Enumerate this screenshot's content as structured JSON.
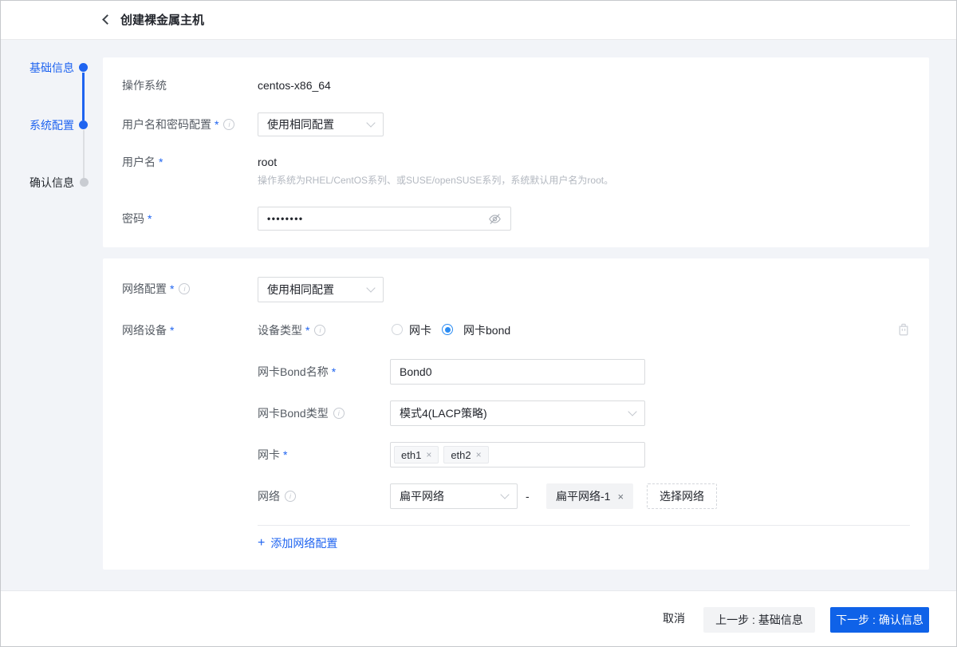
{
  "colors": {
    "primary": "#0f62e8",
    "link": "#1f64f0",
    "radio": "#2b8cf3",
    "text": "#23262d",
    "label": "#555b63",
    "hint": "#b3b8c0",
    "border": "#d9dbde",
    "page_bg": "#f2f4f8"
  },
  "icons": {
    "close": "×",
    "plus": "+"
  },
  "marks": {
    "required": "*"
  },
  "header": {
    "title": "创建裸金属主机"
  },
  "stepper": {
    "steps": [
      {
        "label": "基础信息",
        "state": "done"
      },
      {
        "label": "系统配置",
        "state": "active"
      },
      {
        "label": "确认信息",
        "state": "pending"
      }
    ]
  },
  "system_card": {
    "os_label": "操作系统",
    "os_value": "centos-x86_64",
    "credential_label": "用户名和密码配置",
    "credential_value": "使用相同配置",
    "username_label": "用户名",
    "username_value": "root",
    "username_hint": "操作系统为RHEL/CentOS系列、或SUSE/openSUSE系列，系统默认用户名为root。",
    "password_label": "密码",
    "password_value": "••••••••"
  },
  "network_card": {
    "config_label": "网络配置",
    "config_value": "使用相同配置",
    "device_label": "网络设备",
    "device_type_label": "设备类型",
    "device_type_options": [
      {
        "label": "网卡",
        "selected": false
      },
      {
        "label": "网卡bond",
        "selected": true
      }
    ],
    "bond_name_label": "网卡Bond名称",
    "bond_name_value": "Bond0",
    "bond_type_label": "网卡Bond类型",
    "bond_type_value": "模式4(LACP策略)",
    "nic_label": "网卡",
    "nic_tags": [
      "eth1",
      "eth2"
    ],
    "network_label": "网络",
    "network_type_value": "扁平网络",
    "separator": "-",
    "network_tag": "扁平网络-1",
    "choose_network_button": "选择网络",
    "add_config_link": "添加网络配置"
  },
  "footer": {
    "cancel_button": "取消",
    "prev_button": "上一步 : 基础信息",
    "next_button": "下一步 : 确认信息"
  }
}
